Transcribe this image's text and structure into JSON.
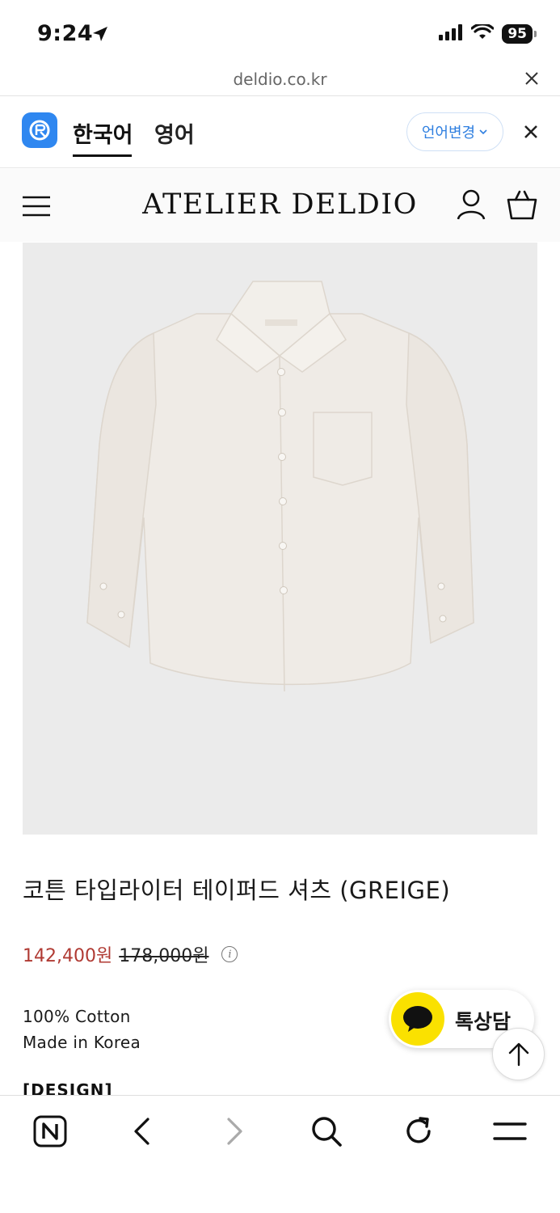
{
  "status_bar": {
    "time": "9:24",
    "battery": "95",
    "icons": [
      "location-arrow-icon",
      "signal-icon",
      "wifi-icon",
      "battery-icon"
    ]
  },
  "url_bar": {
    "url": "deldio.co.kr"
  },
  "translate_bar": {
    "tabs": [
      {
        "label": "한국어",
        "active": true
      },
      {
        "label": "영어",
        "active": false
      }
    ],
    "change_language": "언어변경",
    "accent": "#2f87f0"
  },
  "header": {
    "brand": "ATELIER DELDIO"
  },
  "product": {
    "title": "코튼 타입라이터 테이퍼드 셔츠 (GREIGE)",
    "sale_price": "142,400원",
    "original_price": "178,000원",
    "info": "i",
    "description": [
      "100% Cotton",
      "Made in Korea"
    ],
    "section_label": "[DESIGN]",
    "sale_color": "#b03a33"
  },
  "floating": {
    "talk_label": "톡상담",
    "talk_color": "#fae100"
  },
  "toolbar": {
    "items": [
      "naver-icon",
      "back-icon",
      "forward-icon",
      "search-icon",
      "refresh-icon",
      "menu-icon"
    ]
  }
}
